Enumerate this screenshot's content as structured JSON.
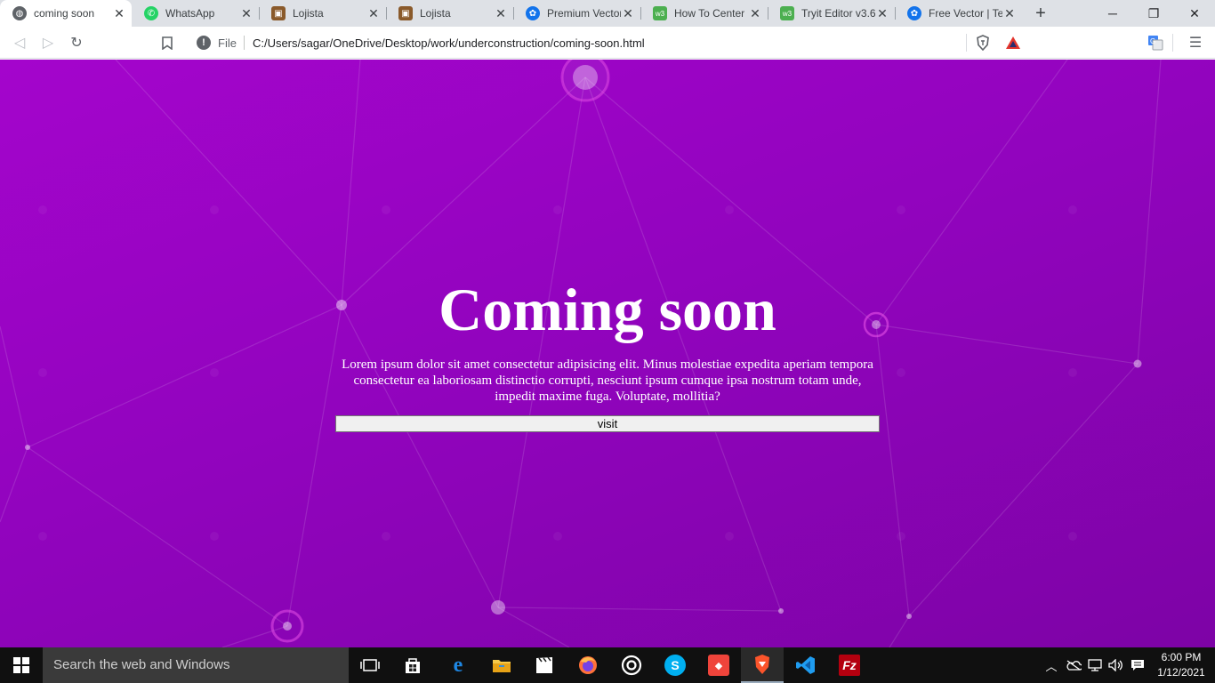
{
  "browser": {
    "tabs": [
      {
        "title": "coming soon",
        "icon": "globe-icon",
        "active": true
      },
      {
        "title": "WhatsApp",
        "icon": "whatsapp-icon",
        "active": false
      },
      {
        "title": "Lojista",
        "icon": "lojista-icon",
        "active": false
      },
      {
        "title": "Lojista",
        "icon": "lojista-icon",
        "active": false
      },
      {
        "title": "Premium Vector",
        "icon": "freepik-icon",
        "active": false
      },
      {
        "title": "How To Center a",
        "icon": "w3schools-icon",
        "active": false
      },
      {
        "title": "Tryit Editor v3.6",
        "icon": "w3schools-icon",
        "active": false
      },
      {
        "title": "Free Vector | Tec",
        "icon": "freepik-icon",
        "active": false
      }
    ],
    "address": {
      "scheme_label": "File",
      "url": "C:/Users/sagar/OneDrive/Desktop/work/underconstruction/coming-soon.html"
    }
  },
  "page": {
    "title": "Coming soon",
    "description": "Lorem ipsum dolor sit amet consectetur adipisicing elit. Minus molestiae expedita aperiam tempora consectetur ea laboriosam distinctio corrupti, nesciunt ipsum cumque ipsa nostrum totam unde, impedit maxime fuga. Voluptate, mollitia?",
    "button_label": "visit"
  },
  "taskbar": {
    "search_placeholder": "Search the web and Windows",
    "time": "6:00 PM",
    "date": "1/12/2021"
  },
  "colors": {
    "background_top": "#a405cc",
    "background_bottom": "#7d03a6",
    "text": "#ffffff"
  }
}
